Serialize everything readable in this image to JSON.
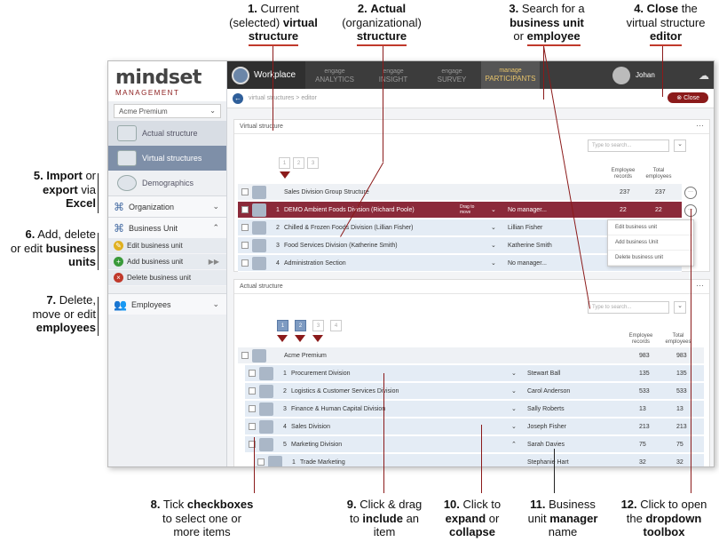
{
  "annotations": {
    "a1": {
      "n": "1.",
      "l1": "Current",
      "l2": "(selected)",
      "l2b": "virtual",
      "l3b": "structure"
    },
    "a2": {
      "n": "2.",
      "l1b": "Actual",
      "l2": "(organizational)",
      "l3b": "structure"
    },
    "a3": {
      "n": "3.",
      "l1": "Search for a",
      "l2b": "business unit",
      "l3": "or",
      "l3b": "employee"
    },
    "a4": {
      "n": "4.",
      "l1b": "Close",
      "l1": "the",
      "l2": "virtual structure",
      "l3b": "editor"
    },
    "a5": {
      "n": "5.",
      "l1b": "Import",
      "l1": "or",
      "l2b": "export",
      "l2": "via",
      "l3b": "Excel"
    },
    "a6": {
      "n": "6.",
      "l1": "Add, delete",
      "l2": "or edit",
      "l2b": "business",
      "l3b": "units"
    },
    "a7": {
      "n": "7.",
      "l1": "Delete,",
      "l2": "move or edit",
      "l3b": "employees"
    },
    "a8": {
      "n": "8.",
      "l1": "Tick",
      "l1b": "checkboxes",
      "l2": "to select one or",
      "l3": "more items"
    },
    "a9": {
      "n": "9.",
      "l1": "Click & drag",
      "l2": "to",
      "l2b": "include",
      "l2c": "an",
      "l3": "item"
    },
    "a10": {
      "n": "10.",
      "l1": "Click to",
      "l2b": "expand",
      "l2": "or",
      "l3b": "collapse"
    },
    "a11": {
      "n": "11.",
      "l1": "Business",
      "l2": "unit",
      "l2b": "manager",
      "l3": "name"
    },
    "a12": {
      "n": "12.",
      "l1": "Click to open",
      "l2": "the",
      "l2b": "dropdown",
      "l3b": "toolbox"
    }
  },
  "logo": {
    "main": "mindset",
    "sub": "MANAGEMENT"
  },
  "company": "Acme Premium",
  "sidebar": {
    "items": [
      {
        "label": "Actual structure"
      },
      {
        "label": "Virtual structures"
      },
      {
        "label": "Demographics"
      }
    ],
    "sections": [
      {
        "label": "Organization"
      },
      {
        "label": "Business Unit"
      }
    ],
    "bu_actions": [
      {
        "label": "Edit business unit"
      },
      {
        "label": "Add business unit"
      },
      {
        "label": "Delete business unit"
      }
    ],
    "employees": "Employees"
  },
  "topbar": {
    "workplace": "Workplace",
    "tabs": [
      {
        "l1": "engage",
        "l2": "ANALYTICS"
      },
      {
        "l1": "engage",
        "l2": "INSIGHT"
      },
      {
        "l1": "engage",
        "l2": "SURVEY"
      },
      {
        "l1": "manage",
        "l2": "PARTICIPANTS"
      }
    ],
    "user": "Johan"
  },
  "crumb": "virtual structures > editor",
  "close_label": "Close",
  "virtual": {
    "title": "Virtual structure",
    "search_placeholder": "Type to search...",
    "levels": [
      "1",
      "2",
      "3"
    ],
    "col_emp": "Employee records",
    "col_tot": "Total employees",
    "rows": [
      {
        "num": "",
        "name": "Sales Division Group Structure",
        "mgr": "",
        "e": "237",
        "t": "237"
      },
      {
        "num": "1",
        "name": "DEMO Ambient Foods Division (Richard Poole)",
        "mgr": "No manager...",
        "e": "22",
        "t": "22",
        "drag": "Drag to move"
      },
      {
        "num": "2",
        "name": "Chilled & Frozen Foods Division (Lillian Fisher)",
        "mgr": "Lillian Fisher",
        "e": "",
        "t": ""
      },
      {
        "num": "3",
        "name": "Food Services Division (Katherine Smith)",
        "mgr": "Katherine Smith",
        "e": "",
        "t": ""
      },
      {
        "num": "4",
        "name": "Administration Section",
        "mgr": "No manager...",
        "e": "",
        "t": ""
      }
    ],
    "menu": [
      "Edit business unit",
      "Add business Unit",
      "Delete business unit"
    ]
  },
  "actual": {
    "title": "Actual structure",
    "search_placeholder": "Type to search...",
    "levels": [
      "1",
      "2",
      "3",
      "4"
    ],
    "col_emp": "Employee records",
    "col_tot": "Total employees",
    "rows": [
      {
        "num": "",
        "name": "Acme Premium",
        "mgr": "",
        "e": "983",
        "t": "983"
      },
      {
        "num": "1",
        "name": "Procurement Division",
        "mgr": "Stewart Ball",
        "e": "135",
        "t": "135"
      },
      {
        "num": "2",
        "name": "Logistics & Customer Services Division",
        "mgr": "Carol Anderson",
        "e": "533",
        "t": "533"
      },
      {
        "num": "3",
        "name": "Finance & Human Capital Division",
        "mgr": "Sally Roberts",
        "e": "13",
        "t": "13"
      },
      {
        "num": "4",
        "name": "Sales Division",
        "mgr": "Joseph Fisher",
        "e": "213",
        "t": "213"
      },
      {
        "num": "5",
        "name": "Marketing Division",
        "mgr": "Sarah Davies",
        "e": "75",
        "t": "75"
      },
      {
        "num": "1",
        "name": "Trade Marketing",
        "mgr": "Stephanie Hart",
        "e": "32",
        "t": "32"
      }
    ]
  }
}
